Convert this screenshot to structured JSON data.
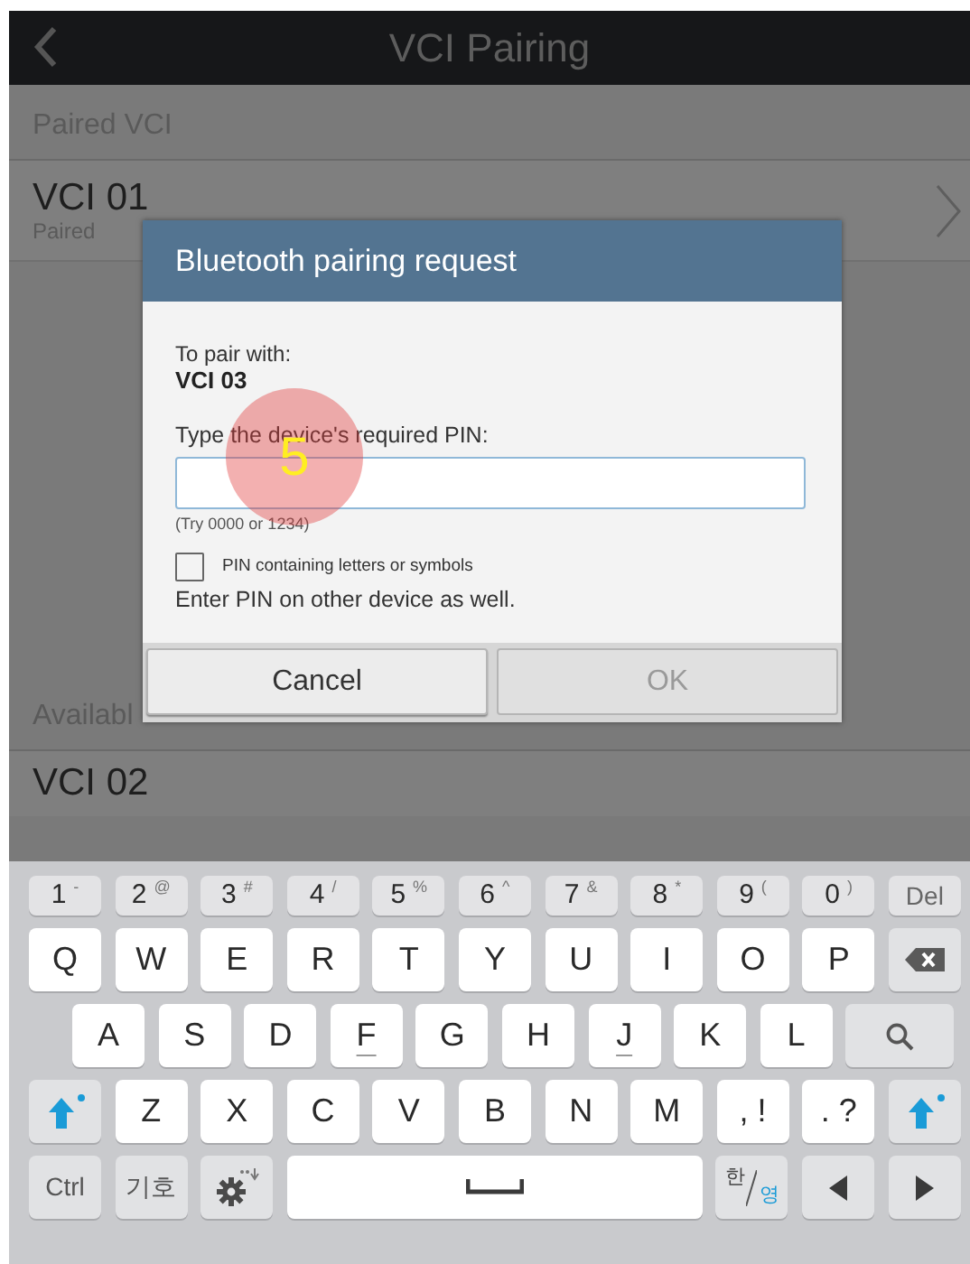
{
  "top_bar": {
    "title": "VCI Pairing"
  },
  "sections": [
    {
      "header": "Paired VCI",
      "items": [
        {
          "name": "VCI 01",
          "status": "Paired",
          "kind": "chevron"
        }
      ]
    },
    {
      "header": "Availabl",
      "items": [
        {
          "name": "VCI 02",
          "kind": "plain"
        }
      ]
    }
  ],
  "dialog": {
    "title": "Bluetooth pairing request",
    "pair_label": "To pair with:",
    "device": "VCI 03",
    "pin_label": "Type the device's required PIN:",
    "hint": "(Try 0000 or 1234)",
    "checkbox": {
      "label": "PIN containing letters or symbols",
      "checked": false
    },
    "note": "Enter PIN on other device as well.",
    "buttons": [
      {
        "label": "Cancel",
        "disabled": false
      },
      {
        "label": "OK",
        "disabled": true
      }
    ]
  },
  "annotation": {
    "label": "5"
  },
  "keyboard": {
    "number_row": [
      {
        "kind": "num",
        "label": "1",
        "sub": "-"
      },
      {
        "kind": "num",
        "label": "2",
        "sub": "@"
      },
      {
        "kind": "num",
        "label": "3",
        "sub": "#"
      },
      {
        "kind": "num",
        "label": "4",
        "sub": "/"
      },
      {
        "kind": "num",
        "label": "5",
        "sub": "%"
      },
      {
        "kind": "num",
        "label": "6",
        "sub": "^"
      },
      {
        "kind": "num",
        "label": "7",
        "sub": "&"
      },
      {
        "kind": "num",
        "label": "8",
        "sub": "*"
      },
      {
        "kind": "num",
        "label": "9",
        "sub": "("
      },
      {
        "kind": "num",
        "label": "0",
        "sub": ")"
      },
      {
        "kind": "numfn",
        "label": "Del"
      }
    ],
    "top_letter_row": [
      {
        "kind": "letter",
        "label": "Q"
      },
      {
        "kind": "letter",
        "label": "W"
      },
      {
        "kind": "letter",
        "label": "E"
      },
      {
        "kind": "letter",
        "label": "R"
      },
      {
        "kind": "letter",
        "label": "T"
      },
      {
        "kind": "letter",
        "label": "Y"
      },
      {
        "kind": "letter",
        "label": "U"
      },
      {
        "kind": "letter",
        "label": "I"
      },
      {
        "kind": "letter",
        "label": "O"
      },
      {
        "kind": "letter",
        "label": "P"
      },
      {
        "kind": "backspace"
      }
    ],
    "middle_letter_row": [
      {
        "kind": "letter",
        "label": "A"
      },
      {
        "kind": "letter",
        "label": "S"
      },
      {
        "kind": "letter",
        "label": "D"
      },
      {
        "kind": "homing",
        "label": "F"
      },
      {
        "kind": "letter",
        "label": "G"
      },
      {
        "kind": "letter",
        "label": "H"
      },
      {
        "kind": "homing",
        "label": "J"
      },
      {
        "kind": "letter",
        "label": "K"
      },
      {
        "kind": "letter",
        "label": "L"
      },
      {
        "kind": "search"
      }
    ],
    "bottom_letter_row": [
      {
        "kind": "shift"
      },
      {
        "kind": "letter",
        "label": "Z"
      },
      {
        "kind": "letter",
        "label": "X"
      },
      {
        "kind": "letter",
        "label": "C"
      },
      {
        "kind": "letter",
        "label": "V"
      },
      {
        "kind": "letter",
        "label": "B"
      },
      {
        "kind": "letter",
        "label": "N"
      },
      {
        "kind": "letter",
        "label": "M"
      },
      {
        "kind": "punct",
        "label": ",",
        "sub": "!"
      },
      {
        "kind": "punct",
        "label": ".",
        "sub": "?"
      },
      {
        "kind": "shift"
      }
    ],
    "function_row": [
      {
        "kind": "fn",
        "label": "Ctrl"
      },
      {
        "kind": "fn",
        "label": "기호"
      },
      {
        "kind": "settings"
      },
      {
        "kind": "space"
      },
      {
        "kind": "lang",
        "label": "한",
        "sub": "영"
      },
      {
        "kind": "left"
      },
      {
        "kind": "right"
      }
    ]
  }
}
